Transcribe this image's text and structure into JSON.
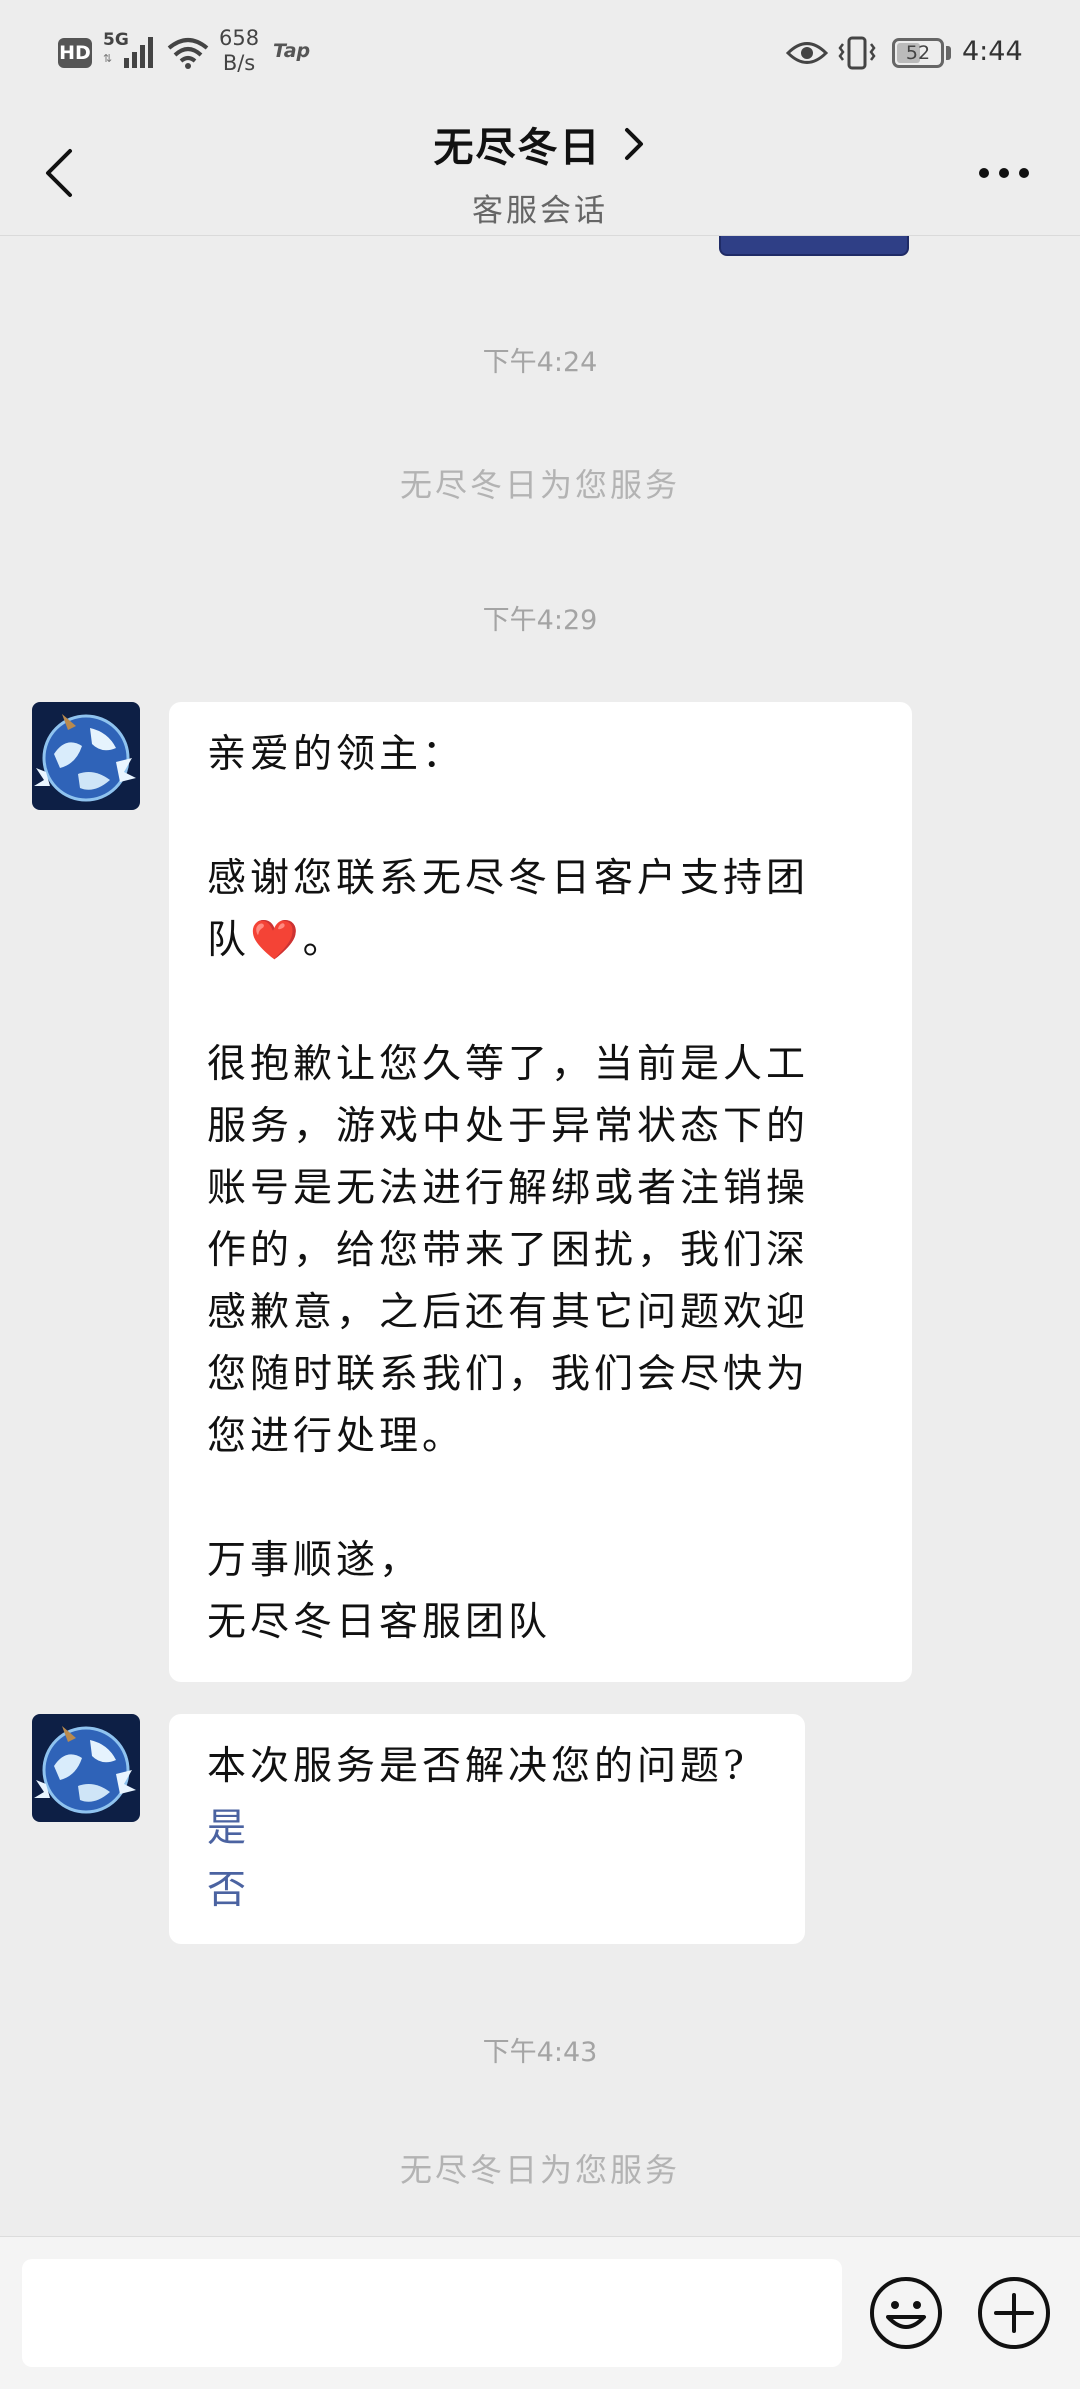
{
  "status_bar": {
    "hd": "HD",
    "network": "5G",
    "speed_value": "658",
    "speed_unit": "B/s",
    "tap": "Tap",
    "battery": "52",
    "time": "4:44"
  },
  "header": {
    "title": "无尽冬日",
    "subtitle": "客服会话"
  },
  "chat": {
    "timestamp_1": "下午4:24",
    "system_1": "无尽冬日为您服务",
    "timestamp_2": "下午4:29",
    "message_1": {
      "greeting": "亲爱的领主：",
      "thanks_line1": "感谢您联系无尽冬日客户支持团",
      "thanks_line2_before": "队",
      "thanks_emoji": "❤️",
      "thanks_line2_after": "。",
      "body_lines": [
        "很抱歉让您久等了，当前是人工",
        "服务，游戏中处于异常状态下的",
        "账号是无法进行解绑或者注销操",
        "作的，给您带来了困扰，我们深",
        "感歉意，之后还有其它问题欢迎",
        "您随时联系我们，我们会尽快为",
        "您进行处理。"
      ],
      "closing_1": "万事顺遂，",
      "closing_2": "无尽冬日客服团队"
    },
    "message_2": {
      "question": "本次服务是否解决您的问题?",
      "option_yes": "是",
      "option_no": "否"
    },
    "timestamp_3": "下午4:43",
    "system_2": "无尽冬日为您服务"
  },
  "input": {
    "placeholder": "",
    "value": ""
  },
  "colors": {
    "background": "#ededed",
    "bubble": "#ffffff",
    "link": "#4b63a1",
    "timestamp": "#a4a4a4"
  }
}
